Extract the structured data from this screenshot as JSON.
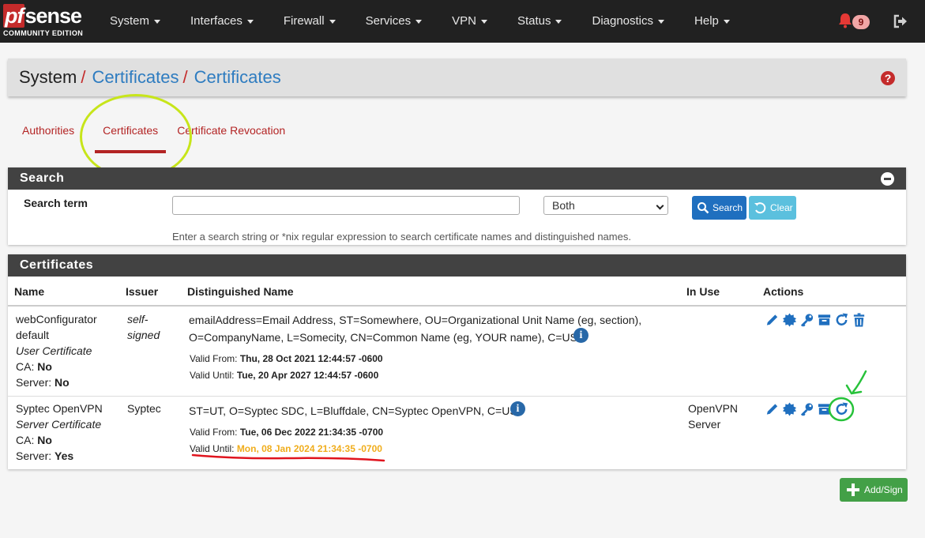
{
  "brand": {
    "logo_pf": "pf",
    "logo_rest": "sense",
    "edition": "COMMUNITY EDITION"
  },
  "nav": {
    "items": [
      "System",
      "Interfaces",
      "Firewall",
      "Services",
      "VPN",
      "Status",
      "Diagnostics",
      "Help"
    ],
    "notification_count": "9"
  },
  "breadcrumb": {
    "root": "System",
    "sep": "/",
    "level1": "Certificates",
    "level2": "Certificates",
    "help": "?"
  },
  "tabs": [
    "Authorities",
    "Certificates",
    "Certificate Revocation"
  ],
  "search": {
    "title": "Search",
    "label": "Search term",
    "input_value": "",
    "select_value": "Both",
    "search_button": "Search",
    "clear_button": "Clear",
    "help_text": "Enter a search string or *nix regular expression to search certificate names and distinguished names."
  },
  "certificates": {
    "title": "Certificates",
    "columns": [
      "Name",
      "Issuer",
      "Distinguished Name",
      "In Use",
      "Actions"
    ],
    "rows": [
      {
        "name": "webConfigurator default",
        "type": "User Certificate",
        "ca_label": "CA:",
        "ca": "No",
        "server_label": "Server:",
        "server": "No",
        "issuer": "self-signed",
        "dn": "emailAddress=Email Address, ST=Somewhere, OU=Organizational Unit Name (eg, section), O=CompanyName, L=Somecity, CN=Common Name (eg, YOUR name), C=US",
        "valid_from_label": "Valid From:",
        "valid_from": "Thu, 28 Oct 2021 12:44:57 -0600",
        "valid_until_label": "Valid Until:",
        "valid_until": "Tue, 20 Apr 2027 12:44:57 -0600",
        "in_use": ""
      },
      {
        "name": "Syptec OpenVPN",
        "type": "Server Certificate",
        "ca_label": "CA:",
        "ca": "No",
        "server_label": "Server:",
        "server": "Yes",
        "issuer": "Syptec",
        "dn": "ST=UT, O=Syptec SDC, L=Bluffdale, CN=Syptec OpenVPN, C=US",
        "valid_from_label": "Valid From:",
        "valid_from": "Tue, 06 Dec 2022 21:34:35 -0700",
        "valid_until_label": "Valid Until:",
        "valid_until": "Mon, 08 Jan 2024 21:34:35 -0700",
        "in_use": "OpenVPN Server"
      }
    ],
    "add_button": "Add/Sign"
  },
  "colors": {
    "navbar": "#212121",
    "accent_red": "#b32424",
    "link_blue": "#2e7cc0",
    "expired_amber": "#f0ad1c",
    "annotation_lime": "#c7e51a"
  }
}
